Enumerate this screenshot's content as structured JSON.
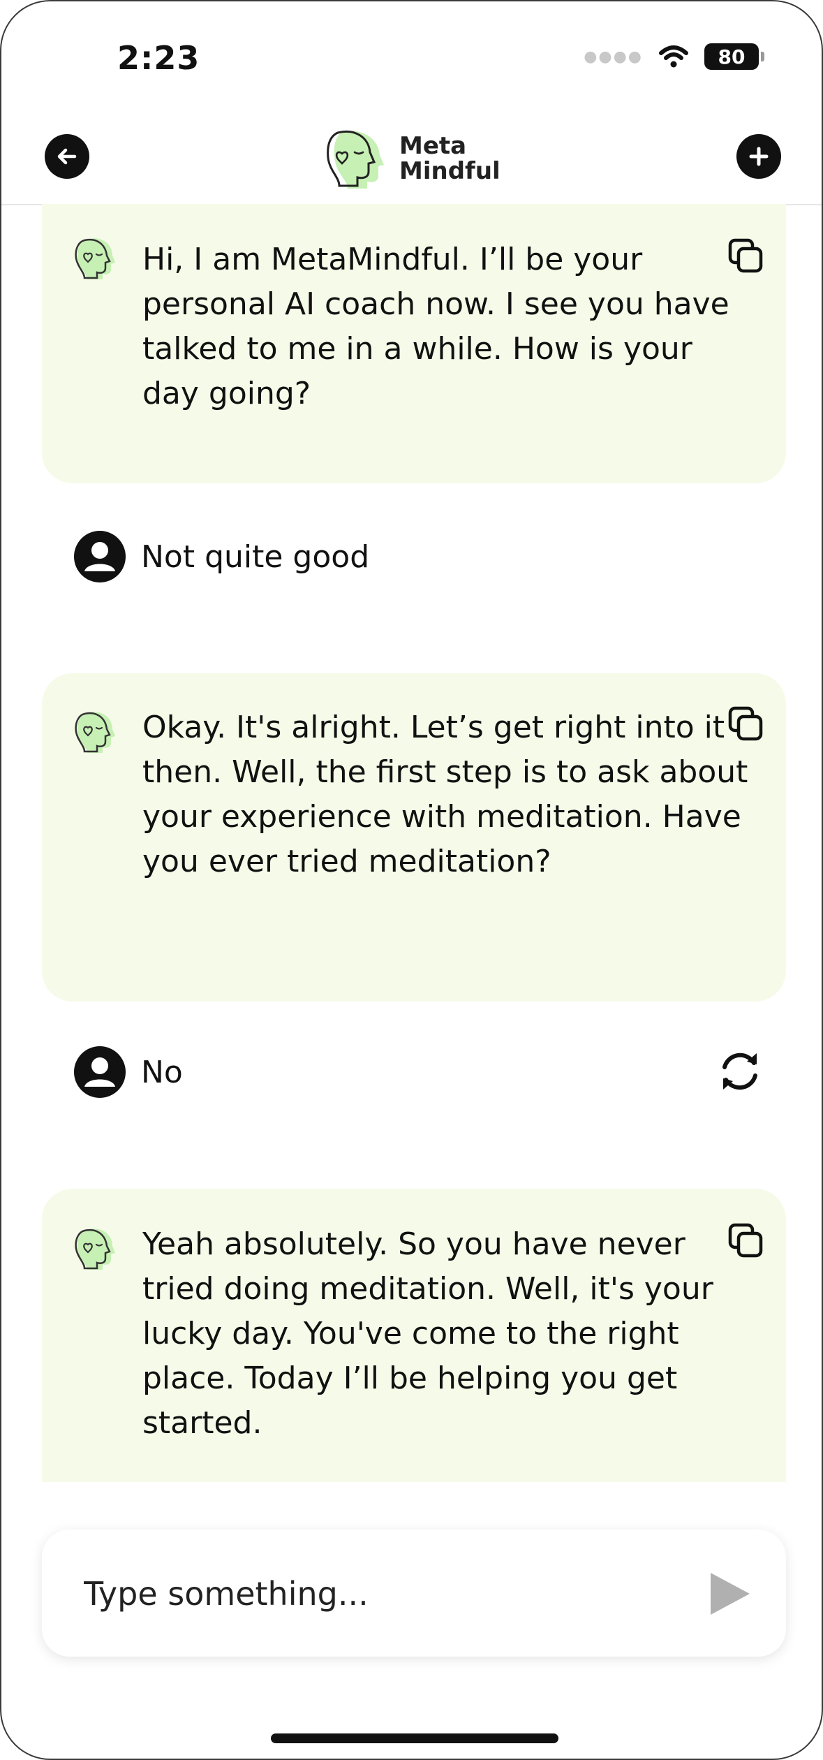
{
  "status_bar": {
    "time": "2:23",
    "battery": "80"
  },
  "header": {
    "logo_line1": "Meta",
    "logo_line2": "Mindful"
  },
  "messages": [
    {
      "role": "assistant",
      "text": "Hi, I am MetaMindful. I’ll be your personal AI coach now. I see you have talked to me in a while. How is your day going?"
    },
    {
      "role": "user",
      "text": "Not quite good"
    },
    {
      "role": "assistant",
      "text": "Okay. It's alright. Let’s get right into it then. Well, the first step is to ask about your experience with meditation. Have you ever tried meditation?"
    },
    {
      "role": "user",
      "text": "No"
    },
    {
      "role": "assistant",
      "text": "Yeah absolutely. So you have never tried doing meditation. Well, it's your lucky day. You've come to the right place. Today I’ll be helping you get started."
    }
  ],
  "composer": {
    "placeholder": "Type something..."
  },
  "colors": {
    "bubble_bg": "#f6fbe9",
    "accent_green": "#c7f0b4",
    "send_disabled": "#b0b0b0"
  }
}
